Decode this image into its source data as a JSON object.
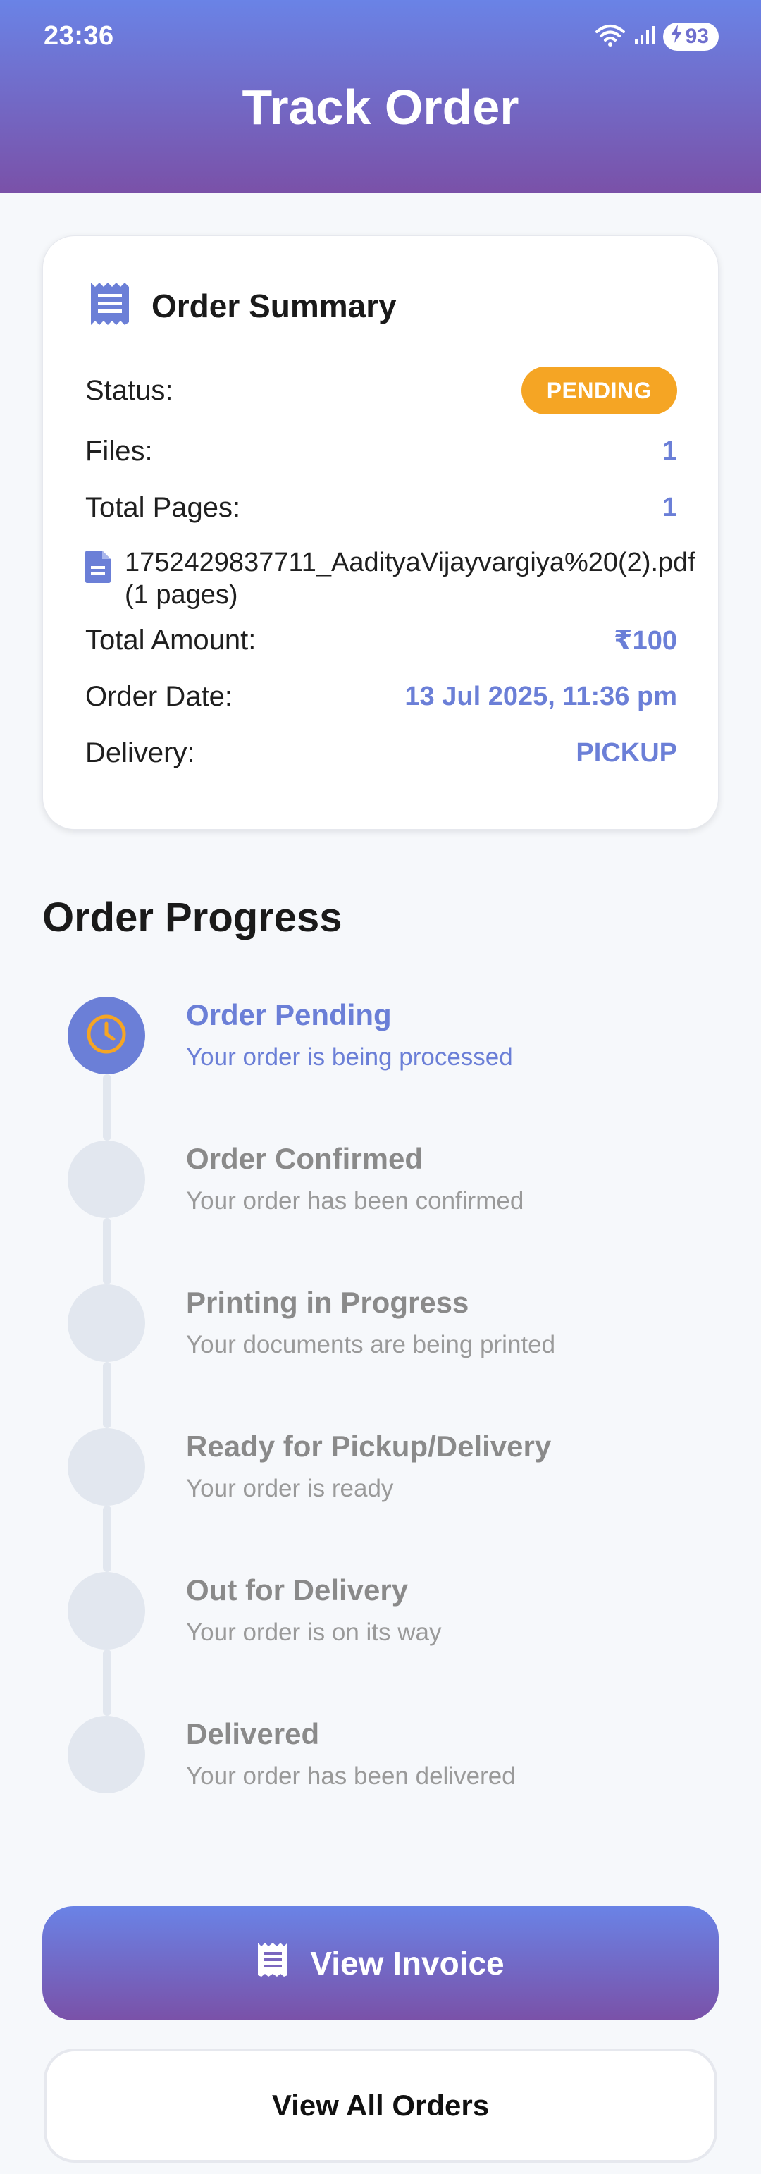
{
  "status_bar": {
    "time": "23:36",
    "battery": "93"
  },
  "header": {
    "title": "Track Order"
  },
  "summary": {
    "title": "Order Summary",
    "status_label": "Status:",
    "status_value": "PENDING",
    "files_label": "Files:",
    "files_value": "1",
    "pages_label": "Total Pages:",
    "pages_value": "1",
    "file_name": "1752429837711_AadityaVijayvargiya%20(2).pdf",
    "file_pages": "(1 pages)",
    "amount_label": "Total Amount:",
    "amount_value": "₹100",
    "date_label": "Order Date:",
    "date_value": "13 Jul 2025, 11:36 pm",
    "delivery_label": "Delivery:",
    "delivery_value": "PICKUP"
  },
  "progress": {
    "title": "Order Progress",
    "steps": [
      {
        "title": "Order Pending",
        "subtitle": "Your order is being processed"
      },
      {
        "title": "Order Confirmed",
        "subtitle": "Your order has been confirmed"
      },
      {
        "title": "Printing in Progress",
        "subtitle": "Your documents are being printed"
      },
      {
        "title": "Ready for Pickup/Delivery",
        "subtitle": "Your order is ready"
      },
      {
        "title": "Out for Delivery",
        "subtitle": "Your order is on its way"
      },
      {
        "title": "Delivered",
        "subtitle": "Your order has been delivered"
      }
    ]
  },
  "actions": {
    "invoice_label": "View Invoice",
    "all_orders_label": "View All Orders"
  },
  "colors": {
    "accent": "#6b7fd7",
    "pending": "#f5a524",
    "inactive": "#e2e7ef"
  }
}
